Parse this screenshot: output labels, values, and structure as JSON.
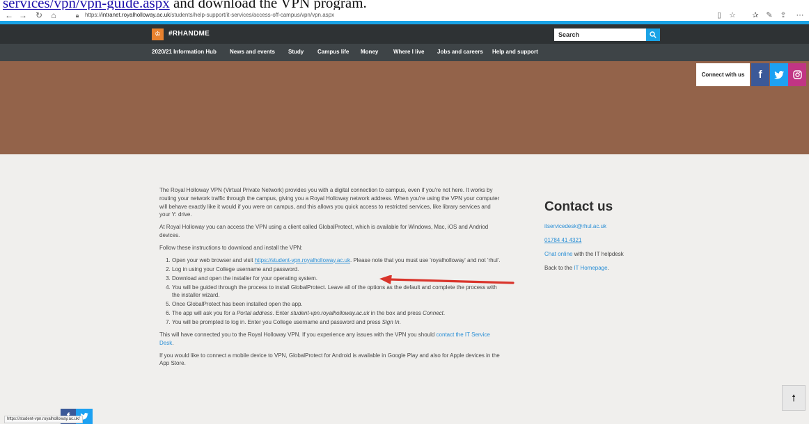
{
  "doc_header": {
    "link_text": "services/vpn/vpn-guide.aspx",
    "after_text": " and download the VPN program."
  },
  "browser": {
    "url_prefix": "https://",
    "url_domain": "intranet.royalholloway.ac.uk",
    "url_path": "/students/help-support/it-services/access-off-campus/vpn/vpn.aspx",
    "icons": {
      "back": "arrow-left-icon",
      "forward": "arrow-right-icon",
      "refresh": "refresh-icon",
      "home": "home-icon",
      "lock": "lock-icon",
      "reading_view": "reading-view-icon",
      "favorite": "star-icon",
      "favorites": "favorites-icon",
      "notes": "pen-icon",
      "share": "share-icon",
      "more": "more-icon"
    }
  },
  "site": {
    "brand": "#RHANDME",
    "search_placeholder": "Search",
    "nav": [
      "2020/21 Information Hub",
      "News and events",
      "Study",
      "Campus life",
      "Money",
      "Where I live",
      "Jobs and careers",
      "Help and support"
    ],
    "connect_label": "Connect with us",
    "social": [
      "f",
      "t",
      "ig"
    ],
    "colors": {
      "accent_blue": "#1aa3e6",
      "header_dark": "#2e3234",
      "nav_dark": "#3e4447",
      "hero_brown": "#93634a",
      "logo_orange": "#e8812e",
      "link_blue": "#2a8fd6",
      "arrow_red": "#d9342b"
    }
  },
  "content": {
    "intro": "The Royal Holloway VPN (Virtual Private Network) provides you with a digital connection to campus, even if you're not here. It works by routing your network traffic through the campus, giving you a Royal Holloway network address. When you're using the VPN your computer will behave exactly like it would if you were on campus, and this allows you quick access to restricted services, like library services and your Y: drive.",
    "globalprotect": "At Royal Holloway you can access the VPN using a client called GlobalProtect, which is available for Windows, Mac, iOS and Andriod devices.",
    "follow": "Follow these instructions to download and install the VPN:",
    "step1_before": "Open your web browser and visit ",
    "step1_link": "https://student-vpn.royalholloway.ac.uk",
    "step1_after": ". Please note that you must use 'royalholloway' and not 'rhul'.",
    "step2": "Log in using your College username and password.",
    "step3": "Download and open the installer for your operating system.",
    "step4": "You will be guided through the process to install GlobalProtect. Leave all of the options as the default and complete the process with the installer wizard.",
    "step5": "Once GlobalProtect has been installed open the app.",
    "step6_a": "The app will ask you for a ",
    "step6_portal": "Portal address",
    "step6_b": ". Enter ",
    "step6_addr": "student-vpn.royalholloway.ac.uk",
    "step6_c": " in the box and press ",
    "step6_connect": "Connect",
    "step6_d": ".",
    "step7_a": "You will be prompted to log in. Enter you College username and password and press ",
    "step7_signin": "Sign In",
    "step7_b": ".",
    "connected_a": "This will have connected you to the Royal Holloway VPN. If you experience any issues with the VPN you should ",
    "connected_link": "contact the IT Service Desk",
    "connected_b": ".",
    "mobile": "If you would like to connect a mobile device to VPN, GlobalProtect for Android is available in Google Play and also for Apple devices in the App Store."
  },
  "contact": {
    "title": "Contact us",
    "email": "itservicedesk@rhul.ac.uk",
    "phone": "01784 41 4321",
    "chat_link": "Chat online",
    "chat_rest": " with the IT helpdesk",
    "back_text": "Back to the ",
    "back_link": "IT Homepage",
    "back_end": "."
  },
  "status_url": "https://student-vpn.royalholloway.ac.uk/"
}
